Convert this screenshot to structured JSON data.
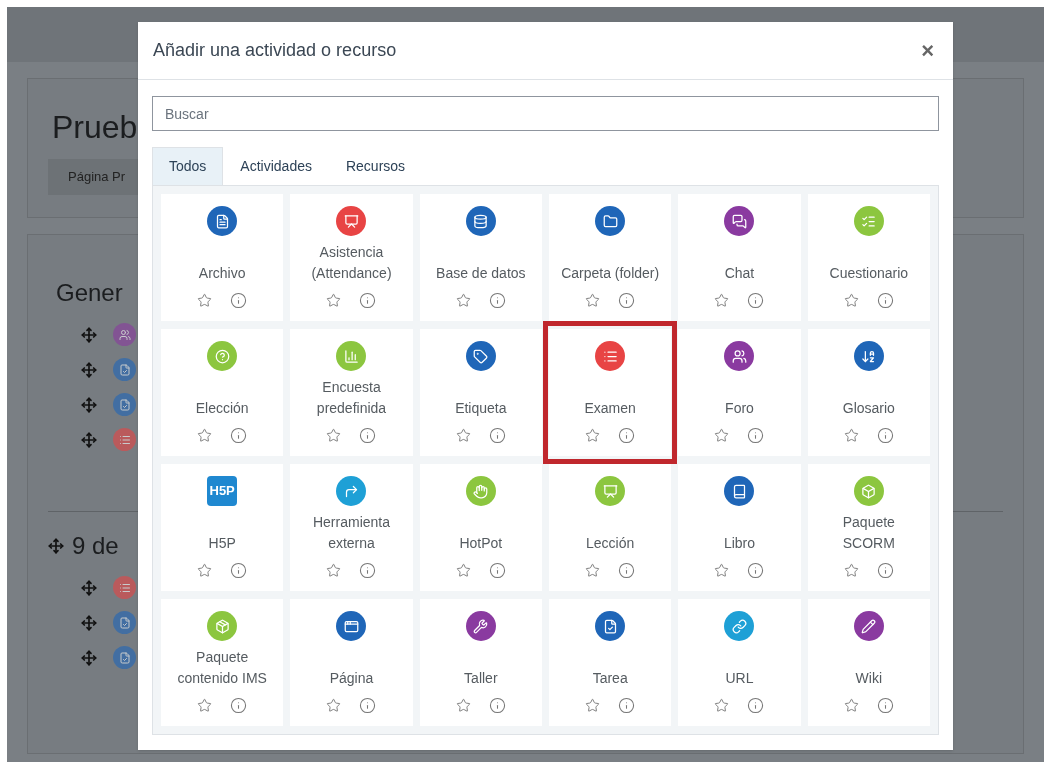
{
  "background": {
    "course_title": "Prueb",
    "nav_button": "Página Pr",
    "sections": [
      {
        "title": "Gener",
        "movable": false,
        "activities": [
          {
            "kind": "forum"
          },
          {
            "kind": "assign"
          },
          {
            "kind": "assign"
          },
          {
            "kind": "quiz"
          }
        ]
      },
      {
        "title": "9 de",
        "movable": true,
        "activities": [
          {
            "kind": "quiz"
          },
          {
            "kind": "assign"
          },
          {
            "kind": "assign"
          }
        ]
      }
    ]
  },
  "dialog": {
    "title": "Añadir una actividad o recurso",
    "close": "×",
    "search": {
      "placeholder": "Buscar"
    },
    "tabs": [
      {
        "label": "Todos",
        "selected": true
      },
      {
        "label": "Actividades",
        "selected": false
      },
      {
        "label": "Recursos",
        "selected": false
      }
    ],
    "items": [
      {
        "name": "Archivo",
        "kind": "file",
        "highlighted": false
      },
      {
        "name": "Asistencia (Attendance)",
        "kind": "attendance",
        "highlighted": false
      },
      {
        "name": "Base de datos",
        "kind": "database",
        "highlighted": false
      },
      {
        "name": "Carpeta (folder)",
        "kind": "folder",
        "highlighted": false
      },
      {
        "name": "Chat",
        "kind": "chat",
        "highlighted": false
      },
      {
        "name": "Cuestionario",
        "kind": "questionnaire",
        "highlighted": false
      },
      {
        "name": "Elección",
        "kind": "choice",
        "highlighted": false
      },
      {
        "name": "Encuesta predefinida",
        "kind": "survey",
        "highlighted": false
      },
      {
        "name": "Etiqueta",
        "kind": "label",
        "highlighted": false
      },
      {
        "name": "Examen",
        "kind": "quiz",
        "highlighted": true
      },
      {
        "name": "Foro",
        "kind": "forum",
        "highlighted": false
      },
      {
        "name": "Glosario",
        "kind": "glossary",
        "highlighted": false
      },
      {
        "name": "H5P",
        "kind": "h5p",
        "logo": "H5P",
        "highlighted": false
      },
      {
        "name": "Herramienta externa",
        "kind": "lti",
        "highlighted": false
      },
      {
        "name": "HotPot",
        "kind": "hotpot",
        "highlighted": false
      },
      {
        "name": "Lección",
        "kind": "lesson",
        "highlighted": false
      },
      {
        "name": "Libro",
        "kind": "book",
        "highlighted": false
      },
      {
        "name": "Paquete SCORM",
        "kind": "scorm",
        "highlighted": false
      },
      {
        "name": "Paquete contenido IMS",
        "kind": "imscp",
        "highlighted": false
      },
      {
        "name": "Página",
        "kind": "page",
        "highlighted": false
      },
      {
        "name": "Taller",
        "kind": "workshop",
        "highlighted": false
      },
      {
        "name": "Tarea",
        "kind": "assign",
        "highlighted": false
      },
      {
        "name": "URL",
        "kind": "url",
        "highlighted": false
      },
      {
        "name": "Wiki",
        "kind": "wiki",
        "highlighted": false
      }
    ]
  }
}
